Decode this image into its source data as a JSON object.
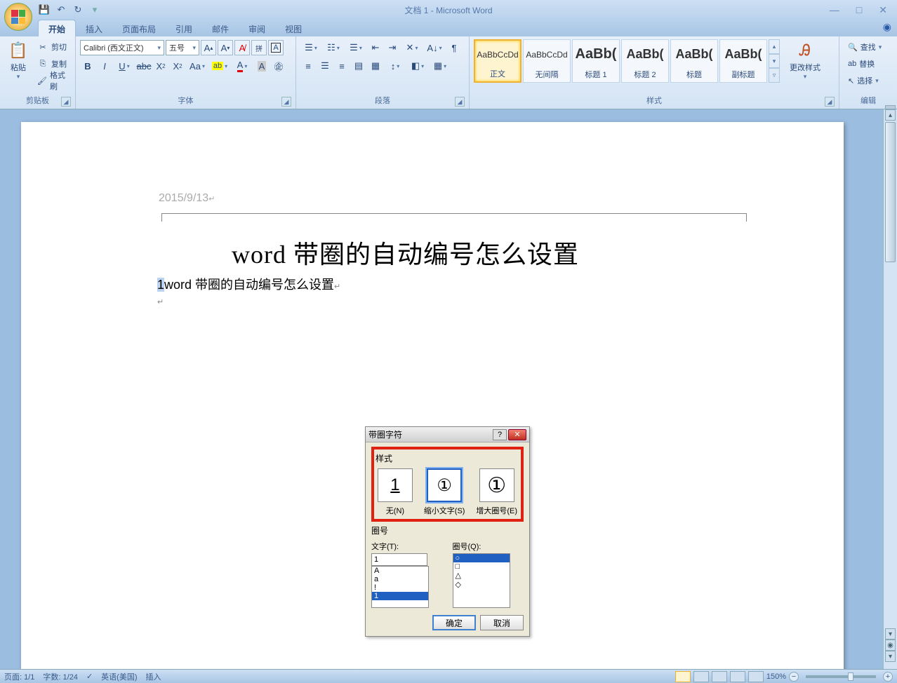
{
  "title": "文档 1 - Microsoft Word",
  "tabs": [
    "开始",
    "插入",
    "页面布局",
    "引用",
    "邮件",
    "审阅",
    "视图"
  ],
  "active_tab": 0,
  "clipboard": {
    "label": "剪贴板",
    "paste": "粘贴",
    "cut": "剪切",
    "copy": "复制",
    "format_painter": "格式刷"
  },
  "font": {
    "label": "字体",
    "name": "Calibri (西文正文)",
    "size": "五号",
    "grow": "A",
    "shrink": "A",
    "clear": "A",
    "change_case": "Aa",
    "phonetic": "变",
    "border": "A",
    "bold": "B",
    "italic": "I",
    "underline": "U",
    "strike": "abc",
    "sub": "X₂",
    "sup": "X²"
  },
  "paragraph": {
    "label": "段落"
  },
  "styles": {
    "label": "样式",
    "change": "更改样式",
    "items": [
      {
        "preview": "AaBbCcDd",
        "name": "正文"
      },
      {
        "preview": "AaBbCcDd",
        "name": "无间隔"
      },
      {
        "preview": "AaBb(",
        "name": "标题 1"
      },
      {
        "preview": "AaBb(",
        "name": "标题 2"
      },
      {
        "preview": "AaBb(",
        "name": "标题"
      },
      {
        "preview": "AaBb(",
        "name": "副标题"
      }
    ]
  },
  "editing": {
    "label": "编辑",
    "find": "查找",
    "replace": "替换",
    "select": "选择"
  },
  "document": {
    "header_date": "2015/9/13",
    "title": "word 带圈的自动编号怎么设置",
    "line_num": "1",
    "line_text": "word 带圈的自动编号怎么设置"
  },
  "dialog": {
    "title": "带圈字符",
    "style_label": "样式",
    "options": [
      {
        "glyph": "1",
        "label": "无(N)"
      },
      {
        "glyph": "①",
        "label": "缩小文字(S)"
      },
      {
        "glyph": "①",
        "label": "增大圈号(E)"
      }
    ],
    "section2_label": "圈号",
    "text_label": "文字(T):",
    "ring_label": "圈号(Q):",
    "text_value": "1",
    "text_options": [
      "A",
      "a",
      "!",
      "1"
    ],
    "ring_options": [
      "○",
      "□",
      "△",
      "◇"
    ],
    "ok": "确定",
    "cancel": "取消"
  },
  "status": {
    "page": "页面: 1/1",
    "words": "字数: 1/24",
    "lang": "英语(美国)",
    "mode": "插入",
    "zoom": "150%"
  }
}
